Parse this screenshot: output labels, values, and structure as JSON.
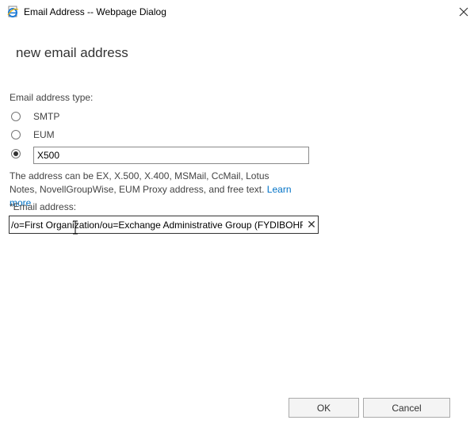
{
  "window": {
    "title": "Email Address -- Webpage Dialog"
  },
  "heading": "new email address",
  "address_type": {
    "label": "Email address type:",
    "options": [
      "SMTP",
      "EUM"
    ],
    "custom_value": "X500",
    "selected": "custom"
  },
  "help": {
    "text": "The address can be EX, X.500, X.400, MSMail, CcMail, Lotus Notes, NovellGroupWise, EUM Proxy address, and free text. ",
    "link": "Learn more"
  },
  "email": {
    "label": "*Email address:",
    "value": "/o=First Organization/ou=Exchange Administrative Group (FYDIBOHF",
    "clear_symbol": "✕"
  },
  "buttons": {
    "ok": "OK",
    "cancel": "Cancel"
  },
  "colors": {
    "link": "#0072c6",
    "ie_icon": "#1e7bd6"
  },
  "icons": {
    "app": "ie-page-icon",
    "close": "close-icon"
  }
}
